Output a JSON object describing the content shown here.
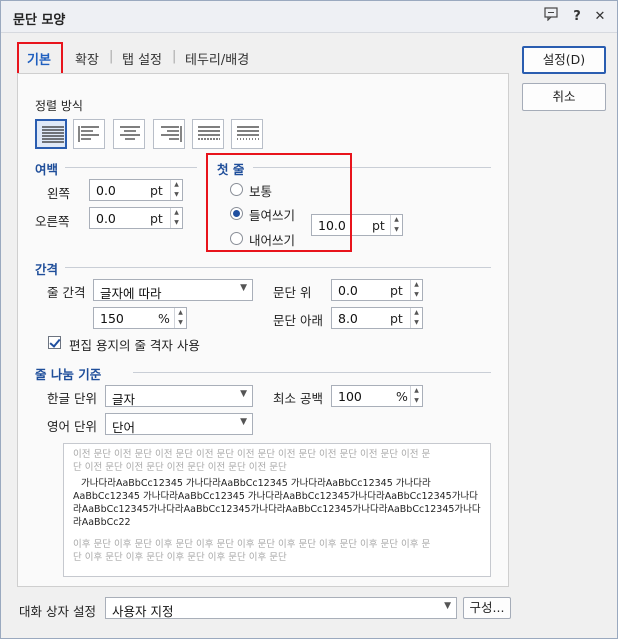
{
  "window": {
    "title": "문단 모양"
  },
  "titlebar_icons": [
    "chat-icon",
    "help-icon",
    "close-icon"
  ],
  "titlebar_glyphs": {
    "help": "?",
    "close": "✕"
  },
  "tabs": [
    {
      "label": "기본",
      "active": true
    },
    {
      "label": "확장"
    },
    {
      "label": "탭 설정"
    },
    {
      "label": "테두리/배경"
    }
  ],
  "tab_separator": "|",
  "alignment": {
    "heading": "정렬 방식",
    "options": [
      "justify",
      "left",
      "center",
      "right",
      "distribute",
      "split"
    ],
    "selected": "justify"
  },
  "margin": {
    "heading": "여백",
    "left_label": "왼쪽",
    "left_value": "0.0",
    "right_label": "오른쪽",
    "right_value": "0.0",
    "unit": "pt"
  },
  "first_line": {
    "heading": "첫 줄",
    "options": [
      "보통",
      "들여쓰기",
      "내어쓰기"
    ],
    "selected": "들여쓰기",
    "value": "10.0",
    "unit": "pt"
  },
  "spacing": {
    "heading": "간격",
    "line_spacing_label": "줄 간격",
    "line_spacing_type": "글자에 따라",
    "line_spacing_value": "150",
    "line_spacing_unit": "%",
    "above_label": "문단 위",
    "above_value": "0.0",
    "below_label": "문단 아래",
    "below_value": "8.0",
    "unit": "pt",
    "grid_checkbox_label": "편집 용지의 줄 격자 사용",
    "grid_checked": true
  },
  "line_break": {
    "heading": "줄 나눔 기준",
    "korean_label": "한글 단위",
    "korean_value": "글자",
    "english_label": "영어 단위",
    "english_value": "단어",
    "min_space_label": "최소 공백",
    "min_space_value": "100",
    "min_space_unit": "%"
  },
  "preview": {
    "before_lines": [
      "이전 문단 이전 문단 이전 문단 이전 문단 이전 문단 이전 문단 이전 문단 이전 문단 이전 문",
      "단 이전 문단 이전 문단 이전 문단 이전 문단 이전 문단"
    ],
    "sample_lines": [
      "가나다라AaBbCc12345     가나다라AaBbCc12345     가나다라AaBbCc12345     가나다라",
      "AaBbCc12345     가나다라AaBbCc12345     가나다라AaBbCc12345가나다라AaBbCc12345가나다",
      "라AaBbCc12345가나다라AaBbCc12345가나다라AaBbCc12345가나다라AaBbCc12345가나다",
      "라AaBbCc22"
    ],
    "after_lines": [
      "이후 문단 이후 문단 이후 문단 이후 문단 이후 문단 이후 문단 이후 문단 이후 문단 이후 문",
      "단 이후 문단 이후 문단 이후 문단 이후 문단 이후 문단"
    ]
  },
  "footer": {
    "settings_label": "대화 상자 설정",
    "settings_value": "사용자 지정",
    "config_button": "구성..."
  },
  "buttons": {
    "ok": "설정(D)",
    "cancel": "취소"
  },
  "colors": {
    "accent": "#2a5db0",
    "section_heading": "#1f4e9a",
    "highlight_box": "#e8141c"
  }
}
